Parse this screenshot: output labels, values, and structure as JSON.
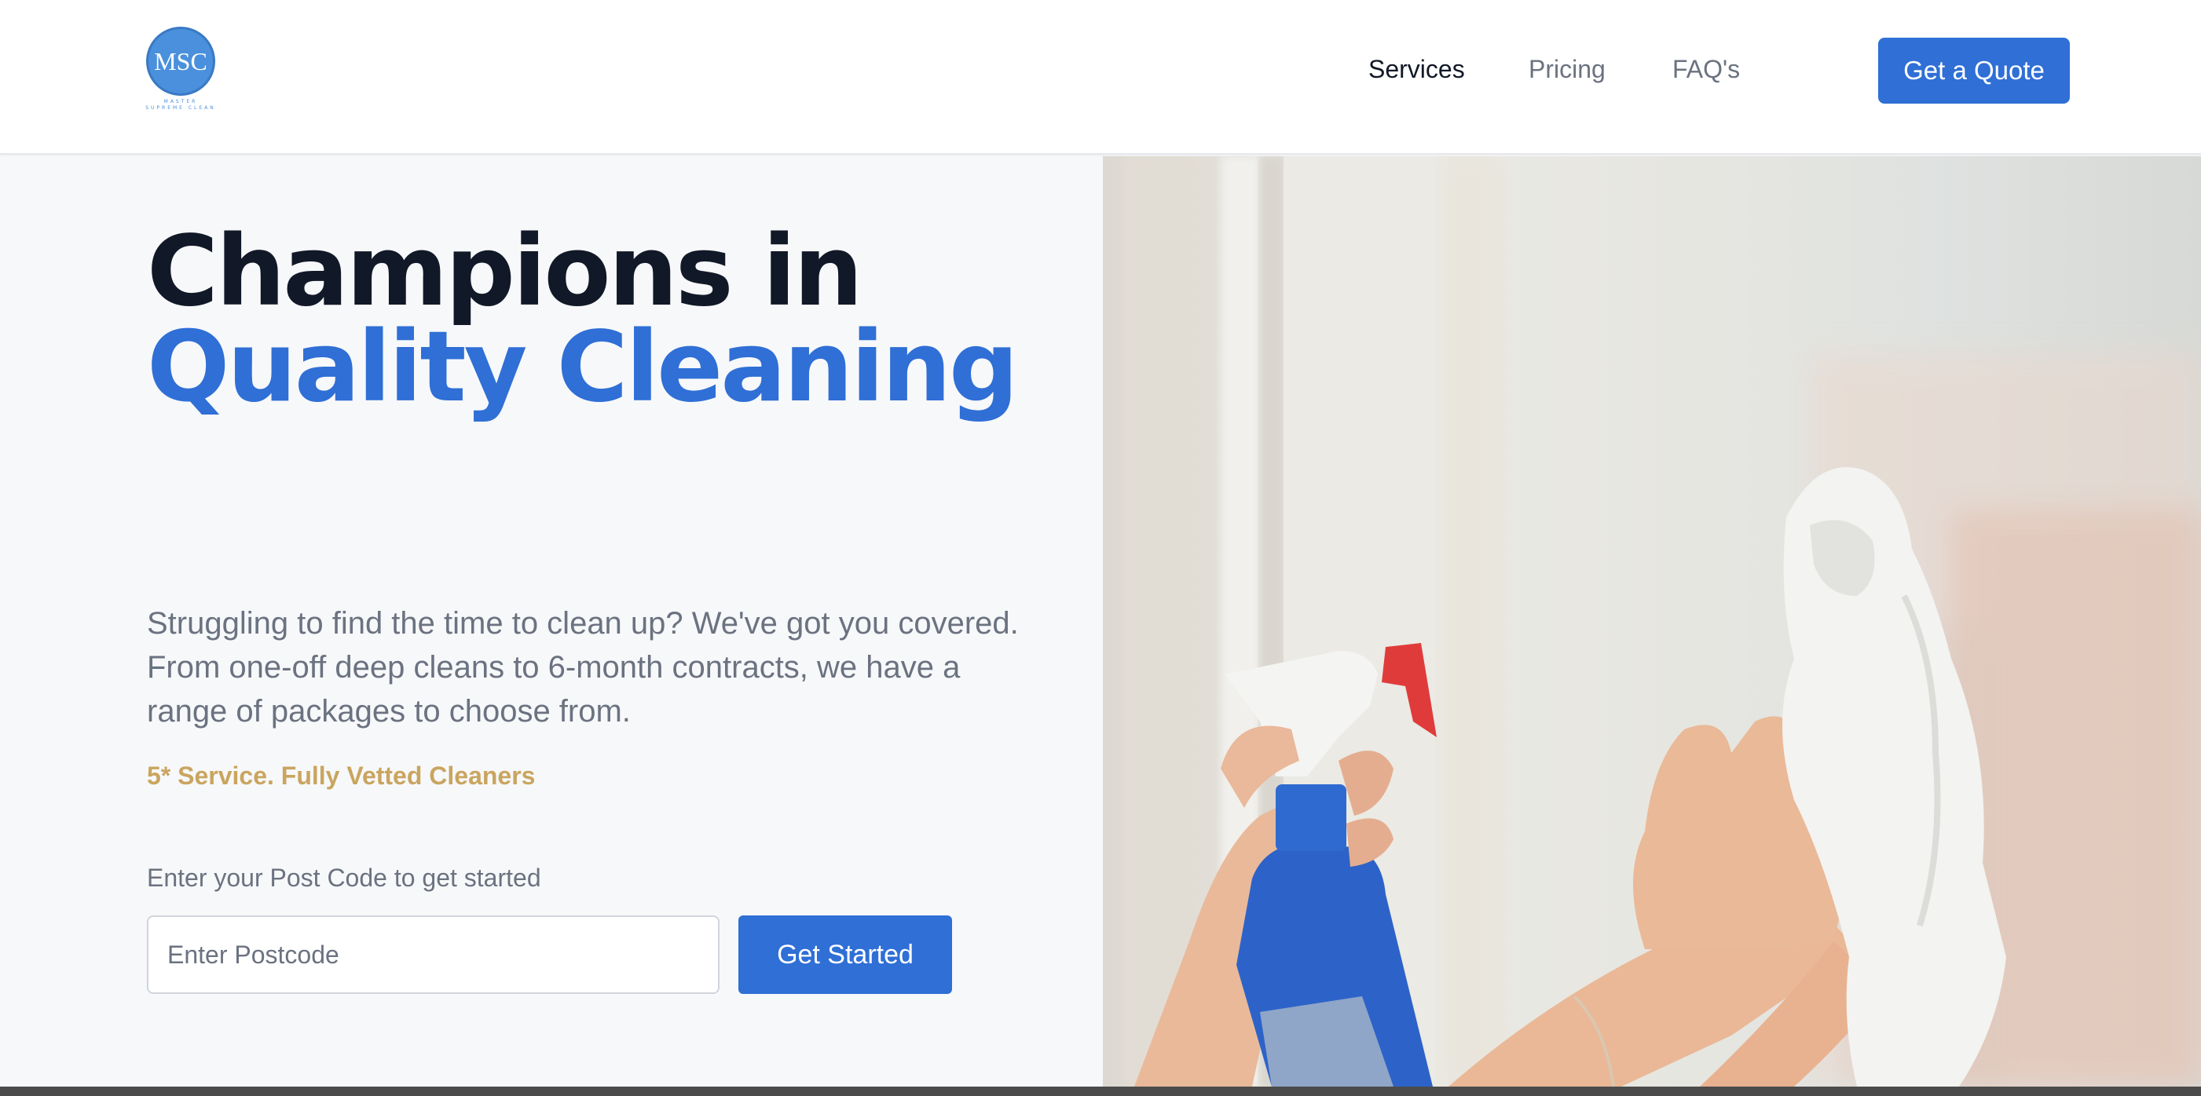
{
  "header": {
    "logo": {
      "initials": "MSC",
      "subtext": "MASTER SUPREME CLEAN"
    },
    "nav": [
      {
        "label": "Services",
        "active": true
      },
      {
        "label": "Pricing",
        "active": false
      },
      {
        "label": "FAQ's",
        "active": false
      }
    ],
    "cta_label": "Get a Quote"
  },
  "hero": {
    "title_line1": "Champions in",
    "title_line2": "Quality Cleaning",
    "subtitle": "Struggling to find the time to clean up? We've got you covered. From one-off deep cleans to 6-month contracts, we have a range of packages to choose from.",
    "tagline": "5* Service. Fully Vetted Cleaners",
    "postcode_label": "Enter your Post Code to get started",
    "postcode_placeholder": "Enter Postcode",
    "submit_label": "Get Started"
  },
  "colors": {
    "accent": "#2f6fd6",
    "gold": "#c9a55f",
    "heading": "#111827",
    "muted": "#6b7280"
  },
  "icons": [
    "msc-logo-icon"
  ]
}
